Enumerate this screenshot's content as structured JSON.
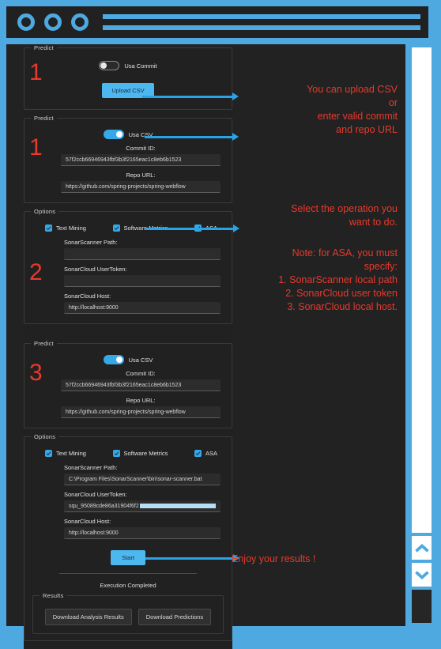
{
  "window": {
    "dots": [
      "dot-1",
      "dot-2",
      "dot-3"
    ],
    "urlbars": 2
  },
  "panels": {
    "predict_1": {
      "legend": "Predict",
      "step_number": "1",
      "toggle_label": "Usa Commit",
      "toggle_on": false,
      "upload_button": "Upload CSV"
    },
    "predict_2": {
      "legend": "Predict",
      "step_number": "1",
      "toggle_label": "Usa CSV",
      "toggle_on": true,
      "commit_id_label": "Commit ID:",
      "commit_id_value": "57f2ccb66946943fbf3b3f2165eac1c8eb6b1523",
      "repo_url_label": "Repo URL:",
      "repo_url_value": "https://github.com/spring-projects/spring-webflow"
    },
    "options_1": {
      "legend": "Options",
      "step_number": "2",
      "checkboxes": [
        {
          "label": "Text Mining",
          "checked": true
        },
        {
          "label": "Software Metrics",
          "checked": true
        },
        {
          "label": "ASA",
          "checked": true
        }
      ],
      "scanner_path_label": "SonarScanner Path:",
      "scanner_path_value": "",
      "usertoken_label": "SonarCloud UserToken:",
      "usertoken_value": "",
      "host_label": "SonarCloud Host:",
      "host_value": "http://localhost:9000"
    },
    "predict_3": {
      "legend": "Predict",
      "step_number": "3",
      "toggle_label": "Usa CSV",
      "toggle_on": true,
      "commit_id_label": "Commit ID:",
      "commit_id_value": "57f2ccb66946943fbf3b3f2165eac1c8eb6b1523",
      "repo_url_label": "Repo URL:",
      "repo_url_value": "https://github.com/spring-projects/spring-webflow"
    },
    "options_2": {
      "legend": "Options",
      "checkboxes": [
        {
          "label": "Text Mining",
          "checked": true
        },
        {
          "label": "Software Metrics",
          "checked": true
        },
        {
          "label": "ASA",
          "checked": true
        }
      ],
      "scanner_path_label": "SonarScanner Path:",
      "scanner_path_value": "C:\\Program Files\\SonarScanner\\bin\\sonar-scanner.bat",
      "usertoken_label": "SonarCloud UserToken:",
      "usertoken_value": "squ_95089cde86a31904f6f2",
      "host_label": "SonarCloud Host:",
      "host_value": "http://localhost:9000"
    },
    "run": {
      "start_button": "Start",
      "status_text": "Execution Completed"
    },
    "results": {
      "legend": "Results",
      "download_analysis_button": "Download Analysis Results",
      "download_predictions_button": "Download Predictions"
    }
  },
  "annotations": [
    {
      "id": "anno-upload",
      "text": "You can upload CSV\nor\nenter valid commit\nand repo URL"
    },
    {
      "id": "anno-options",
      "text": "Select the operation you\nwant to do."
    },
    {
      "id": "anno-note",
      "text": "Note: for ASA, you must\nspecify:\n1. SonarScanner local path\n2. SonarCloud user token\n3. SonarCloud local host."
    },
    {
      "id": "anno-results",
      "text": "Enjoy your results !"
    }
  ],
  "scrollbar": {
    "up_icon": "chevron-up-icon",
    "down_icon": "chevron-down-icon"
  },
  "colors": {
    "accent_blue": "#4da9e0",
    "toggle_blue": "#35a9e8",
    "annotation_red": "#e8392c",
    "panel_bg": "#212121",
    "content_bg": "#222222"
  }
}
